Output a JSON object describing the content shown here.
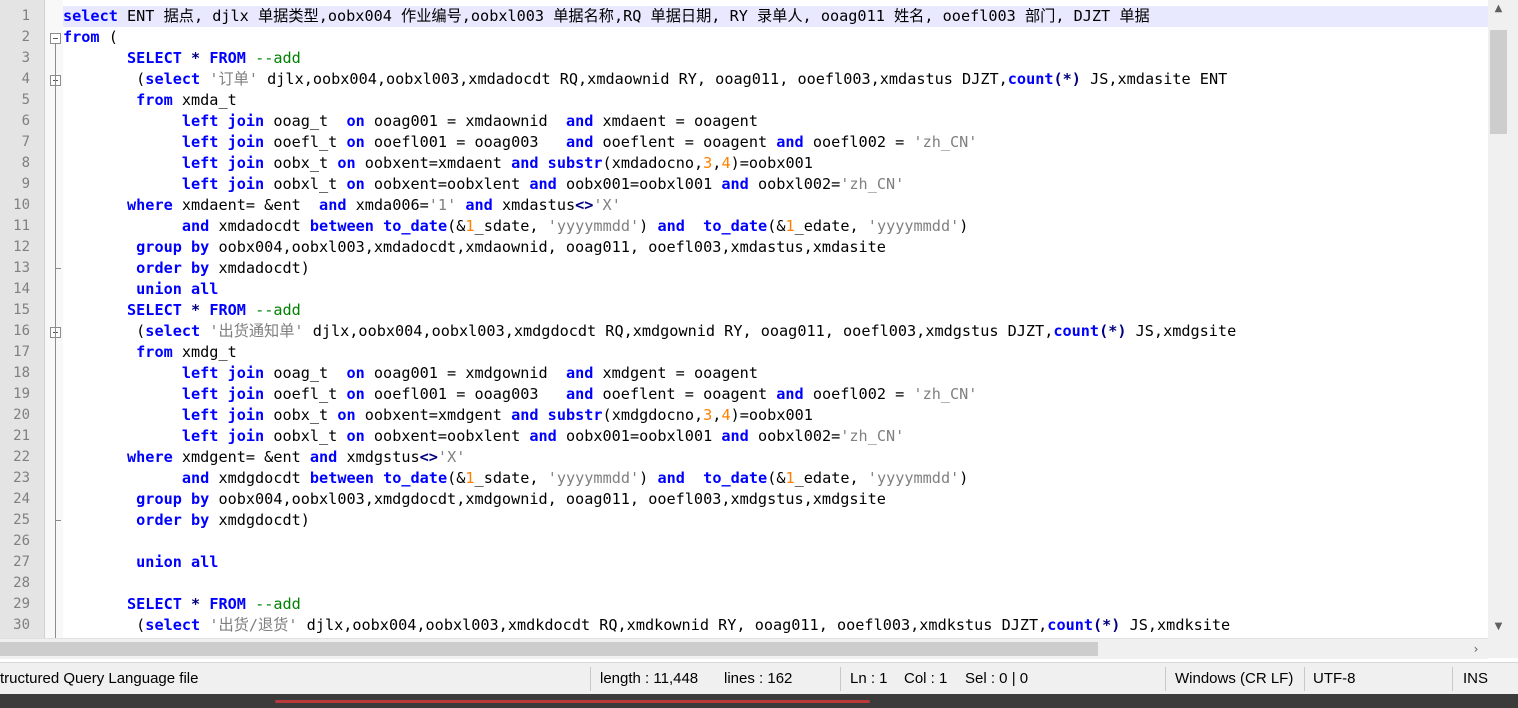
{
  "editor": {
    "current_line": 1,
    "lines": [
      [
        [
          "kw",
          "select"
        ],
        [
          "t",
          " ENT 据点, djlx 单据类型,oobx004 作业编号,oobxl003 单据名称,RQ 单据日期, RY 录单人, ooag011 姓名, ooefl003 部门, DJZT 单据"
        ]
      ],
      [
        [
          "kw",
          "from"
        ],
        [
          "t",
          " ("
        ]
      ],
      [
        [
          "t",
          "       "
        ],
        [
          "kw",
          "SELECT"
        ],
        [
          "t",
          " "
        ],
        [
          "op",
          "*"
        ],
        [
          "t",
          " "
        ],
        [
          "kw",
          "FROM"
        ],
        [
          "t",
          " "
        ],
        [
          "cmt",
          "--add"
        ]
      ],
      [
        [
          "t",
          "        ("
        ],
        [
          "kw",
          "select"
        ],
        [
          "t",
          " "
        ],
        [
          "str",
          "'订单'"
        ],
        [
          "t",
          " djlx,oobx004,oobxl003,xmdadocdt RQ,xmdaownid RY, ooag011, ooefl003,xmdastus DJZT,"
        ],
        [
          "kw",
          "count"
        ],
        [
          "op",
          "(*)"
        ],
        [
          "t",
          " JS,xmdasite ENT"
        ]
      ],
      [
        [
          "t",
          "        "
        ],
        [
          "kw",
          "from"
        ],
        [
          "t",
          " xmda_t"
        ]
      ],
      [
        [
          "t",
          "             "
        ],
        [
          "kw",
          "left join"
        ],
        [
          "t",
          " ooag_t  "
        ],
        [
          "kw",
          "on"
        ],
        [
          "t",
          " ooag001 = xmdaownid  "
        ],
        [
          "kw",
          "and"
        ],
        [
          "t",
          " xmdaent = ooagent"
        ]
      ],
      [
        [
          "t",
          "             "
        ],
        [
          "kw",
          "left join"
        ],
        [
          "t",
          " ooefl_t "
        ],
        [
          "kw",
          "on"
        ],
        [
          "t",
          " ooefl001 = ooag003   "
        ],
        [
          "kw",
          "and"
        ],
        [
          "t",
          " ooeflent = ooagent "
        ],
        [
          "kw",
          "and"
        ],
        [
          "t",
          " ooefl002 = "
        ],
        [
          "str",
          "'zh_CN'"
        ]
      ],
      [
        [
          "t",
          "             "
        ],
        [
          "kw",
          "left join"
        ],
        [
          "t",
          " oobx_t "
        ],
        [
          "kw",
          "on"
        ],
        [
          "t",
          " oobxent=xmdaent "
        ],
        [
          "kw",
          "and"
        ],
        [
          "t",
          " "
        ],
        [
          "kw",
          "substr"
        ],
        [
          "t",
          "(xmdadocno,"
        ],
        [
          "num",
          "3"
        ],
        [
          "t",
          ","
        ],
        [
          "num",
          "4"
        ],
        [
          "t",
          ")=oobx001"
        ]
      ],
      [
        [
          "t",
          "             "
        ],
        [
          "kw",
          "left join"
        ],
        [
          "t",
          " oobxl_t "
        ],
        [
          "kw",
          "on"
        ],
        [
          "t",
          " oobxent=oobxlent "
        ],
        [
          "kw",
          "and"
        ],
        [
          "t",
          " oobx001=oobxl001 "
        ],
        [
          "kw",
          "and"
        ],
        [
          "t",
          " oobxl002="
        ],
        [
          "str",
          "'zh_CN'"
        ]
      ],
      [
        [
          "t",
          "       "
        ],
        [
          "kw",
          "where"
        ],
        [
          "t",
          " xmdaent= &ent  "
        ],
        [
          "kw",
          "and"
        ],
        [
          "t",
          " xmda006="
        ],
        [
          "str",
          "'1'"
        ],
        [
          "t",
          " "
        ],
        [
          "kw",
          "and"
        ],
        [
          "t",
          " xmdastus"
        ],
        [
          "op",
          "<>"
        ],
        [
          "str",
          "'X'"
        ]
      ],
      [
        [
          "t",
          "             "
        ],
        [
          "kw",
          "and"
        ],
        [
          "t",
          " xmdadocdt "
        ],
        [
          "kw",
          "between"
        ],
        [
          "t",
          " "
        ],
        [
          "kw",
          "to_date"
        ],
        [
          "t",
          "(&"
        ],
        [
          "num",
          "1"
        ],
        [
          "t",
          "_sdate, "
        ],
        [
          "str",
          "'yyyymmdd'"
        ],
        [
          "t",
          ") "
        ],
        [
          "kw",
          "and"
        ],
        [
          "t",
          "  "
        ],
        [
          "kw",
          "to_date"
        ],
        [
          "t",
          "(&"
        ],
        [
          "num",
          "1"
        ],
        [
          "t",
          "_edate, "
        ],
        [
          "str",
          "'yyyymmdd'"
        ],
        [
          "t",
          ")"
        ]
      ],
      [
        [
          "t",
          "        "
        ],
        [
          "kw",
          "group by"
        ],
        [
          "t",
          " oobx004,oobxl003,xmdadocdt,xmdaownid, ooag011, ooefl003,xmdastus,xmdasite"
        ]
      ],
      [
        [
          "t",
          "        "
        ],
        [
          "kw",
          "order by"
        ],
        [
          "t",
          " xmdadocdt)"
        ]
      ],
      [
        [
          "t",
          "        "
        ],
        [
          "kw",
          "union all"
        ]
      ],
      [
        [
          "t",
          "       "
        ],
        [
          "kw",
          "SELECT"
        ],
        [
          "t",
          " "
        ],
        [
          "op",
          "*"
        ],
        [
          "t",
          " "
        ],
        [
          "kw",
          "FROM"
        ],
        [
          "t",
          " "
        ],
        [
          "cmt",
          "--add"
        ]
      ],
      [
        [
          "t",
          "        ("
        ],
        [
          "kw",
          "select"
        ],
        [
          "t",
          " "
        ],
        [
          "str",
          "'出货通知单'"
        ],
        [
          "t",
          " djlx,oobx004,oobxl003,xmdgdocdt RQ,xmdgownid RY, ooag011, ooefl003,xmdgstus DJZT,"
        ],
        [
          "kw",
          "count"
        ],
        [
          "op",
          "(*)"
        ],
        [
          "t",
          " JS,xmdgsite"
        ]
      ],
      [
        [
          "t",
          "        "
        ],
        [
          "kw",
          "from"
        ],
        [
          "t",
          " xmdg_t"
        ]
      ],
      [
        [
          "t",
          "             "
        ],
        [
          "kw",
          "left join"
        ],
        [
          "t",
          " ooag_t  "
        ],
        [
          "kw",
          "on"
        ],
        [
          "t",
          " ooag001 = xmdgownid  "
        ],
        [
          "kw",
          "and"
        ],
        [
          "t",
          " xmdgent = ooagent"
        ]
      ],
      [
        [
          "t",
          "             "
        ],
        [
          "kw",
          "left join"
        ],
        [
          "t",
          " ooefl_t "
        ],
        [
          "kw",
          "on"
        ],
        [
          "t",
          " ooefl001 = ooag003   "
        ],
        [
          "kw",
          "and"
        ],
        [
          "t",
          " ooeflent = ooagent "
        ],
        [
          "kw",
          "and"
        ],
        [
          "t",
          " ooefl002 = "
        ],
        [
          "str",
          "'zh_CN'"
        ]
      ],
      [
        [
          "t",
          "             "
        ],
        [
          "kw",
          "left join"
        ],
        [
          "t",
          " oobx_t "
        ],
        [
          "kw",
          "on"
        ],
        [
          "t",
          " oobxent=xmdgent "
        ],
        [
          "kw",
          "and"
        ],
        [
          "t",
          " "
        ],
        [
          "kw",
          "substr"
        ],
        [
          "t",
          "(xmdgdocno,"
        ],
        [
          "num",
          "3"
        ],
        [
          "t",
          ","
        ],
        [
          "num",
          "4"
        ],
        [
          "t",
          ")=oobx001"
        ]
      ],
      [
        [
          "t",
          "             "
        ],
        [
          "kw",
          "left join"
        ],
        [
          "t",
          " oobxl_t "
        ],
        [
          "kw",
          "on"
        ],
        [
          "t",
          " oobxent=oobxlent "
        ],
        [
          "kw",
          "and"
        ],
        [
          "t",
          " oobx001=oobxl001 "
        ],
        [
          "kw",
          "and"
        ],
        [
          "t",
          " oobxl002="
        ],
        [
          "str",
          "'zh_CN'"
        ]
      ],
      [
        [
          "t",
          "       "
        ],
        [
          "kw",
          "where"
        ],
        [
          "t",
          " xmdgent= &ent "
        ],
        [
          "kw",
          "and"
        ],
        [
          "t",
          " xmdgstus"
        ],
        [
          "op",
          "<>"
        ],
        [
          "str",
          "'X'"
        ]
      ],
      [
        [
          "t",
          "             "
        ],
        [
          "kw",
          "and"
        ],
        [
          "t",
          " xmdgdocdt "
        ],
        [
          "kw",
          "between"
        ],
        [
          "t",
          " "
        ],
        [
          "kw",
          "to_date"
        ],
        [
          "t",
          "(&"
        ],
        [
          "num",
          "1"
        ],
        [
          "t",
          "_sdate, "
        ],
        [
          "str",
          "'yyyymmdd'"
        ],
        [
          "t",
          ") "
        ],
        [
          "kw",
          "and"
        ],
        [
          "t",
          "  "
        ],
        [
          "kw",
          "to_date"
        ],
        [
          "t",
          "(&"
        ],
        [
          "num",
          "1"
        ],
        [
          "t",
          "_edate, "
        ],
        [
          "str",
          "'yyyymmdd'"
        ],
        [
          "t",
          ")"
        ]
      ],
      [
        [
          "t",
          "        "
        ],
        [
          "kw",
          "group by"
        ],
        [
          "t",
          " oobx004,oobxl003,xmdgdocdt,xmdgownid, ooag011, ooefl003,xmdgstus,xmdgsite"
        ]
      ],
      [
        [
          "t",
          "        "
        ],
        [
          "kw",
          "order by"
        ],
        [
          "t",
          " xmdgdocdt)"
        ]
      ],
      [
        [
          "t",
          ""
        ]
      ],
      [
        [
          "t",
          "        "
        ],
        [
          "kw",
          "union all"
        ]
      ],
      [
        [
          "t",
          ""
        ]
      ],
      [
        [
          "t",
          "       "
        ],
        [
          "kw",
          "SELECT"
        ],
        [
          "t",
          " "
        ],
        [
          "op",
          "*"
        ],
        [
          "t",
          " "
        ],
        [
          "kw",
          "FROM"
        ],
        [
          "t",
          " "
        ],
        [
          "cmt",
          "--add"
        ]
      ],
      [
        [
          "t",
          "        ("
        ],
        [
          "kw",
          "select"
        ],
        [
          "t",
          " "
        ],
        [
          "str",
          "'出货/退货'"
        ],
        [
          "t",
          " djlx,oobx004,oobxl003,xmdkdocdt RQ,xmdkownid RY, ooag011, ooefl003,xmdkstus DJZT,"
        ],
        [
          "kw",
          "count"
        ],
        [
          "op",
          "(*)"
        ],
        [
          "t",
          " JS,xmdksite"
        ]
      ]
    ],
    "fold_markers": [
      2,
      4,
      16
    ],
    "colors": {
      "keyword": "#0000ff",
      "string": "#808080",
      "number": "#ff8000",
      "comment": "#008000",
      "operator": "#000080",
      "current_line_bg": "#e8e8ff",
      "gutter_bg": "#e4e4e4"
    }
  },
  "scrollbars": {
    "vertical_up_icon": "up-arrow-icon",
    "vertical_down_icon": "down-arrow-icon",
    "horizontal_right_icon": "right-arrow-icon"
  },
  "statusbar": {
    "file_type": "tructured Query Language file",
    "length": "length : 11,448",
    "lines": "lines : 162",
    "ln": "Ln : 1",
    "col": "Col : 1",
    "sel": "Sel : 0 | 0",
    "eol": "Windows (CR LF)",
    "encoding": "UTF-8",
    "mode": "INS"
  }
}
